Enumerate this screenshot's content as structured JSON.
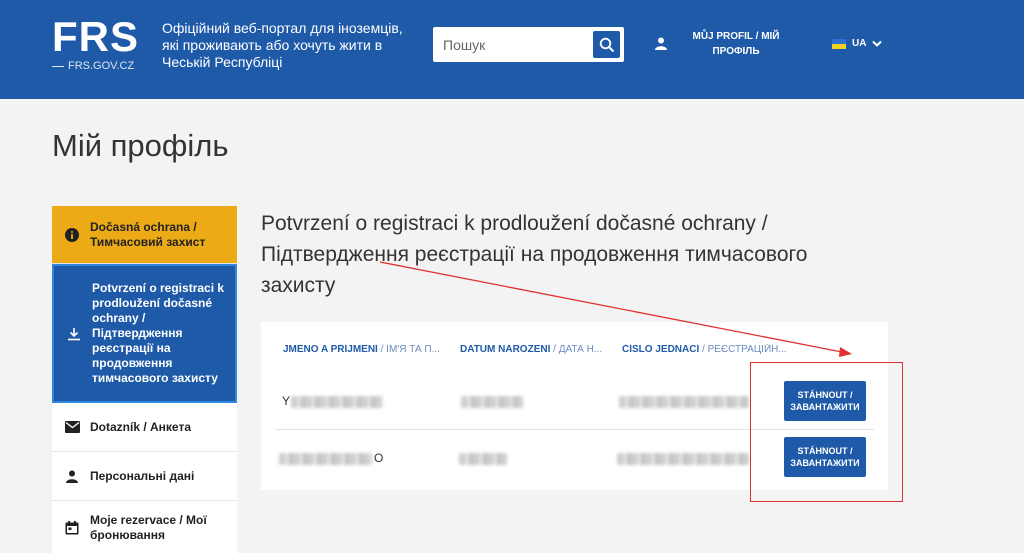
{
  "header": {
    "logo": "FRS",
    "logo_sub": "FRS.GOV.CZ",
    "description": "Офіційний веб-портал для іноземців, які проживають або хочуть жити в Чеській Республіці",
    "search_placeholder": "Пошук",
    "profile_link": "MŮJ PROFIL / МІЙ ПРОФІЛЬ",
    "language": "UA"
  },
  "page": {
    "title": "Мій профіль"
  },
  "sidebar": {
    "items": [
      {
        "label": "Dočasná ochrana / Тимчасовий захист",
        "icon": "info-icon"
      },
      {
        "label": "Potvrzení o registraci k prodloužení dočasné ochrany / Підтвердження реєстрації на продовження тимчасового захисту",
        "icon": "download-icon"
      },
      {
        "label": "Dotazník / Анкета",
        "icon": "envelope-icon"
      },
      {
        "label": "Персональні дані",
        "icon": "user-icon"
      },
      {
        "label": "Moje rezervace / Мої бронювання",
        "icon": "calendar-icon"
      }
    ]
  },
  "main": {
    "heading": "Potvrzení o registraci k prodloužení dočasné ochrany / Підтвердження реєстрації на продовження тимчасового захисту",
    "columns": [
      {
        "bold": "JMÉNO A PŘÍJMENÍ",
        "sub": " / ІМ'Я ТА П..."
      },
      {
        "bold": "DATUM NAROZENÍ",
        "sub": " / ДАТА Н..."
      },
      {
        "bold": "ČÍSLO JEDNACÍ",
        "sub": " / РЕЄСТРАЦІЙН..."
      }
    ],
    "rows": [
      {
        "name_visible": "Y",
        "button": "STÁHNOUT / ЗАВАНТАЖИТИ"
      },
      {
        "name_visible": "O",
        "button": "STÁHNOUT / ЗАВАНТАЖИТИ"
      }
    ]
  },
  "colors": {
    "brand_blue": "#1f5aa8",
    "accent_yellow": "#ecaa17",
    "annotation_red": "#e03030"
  }
}
